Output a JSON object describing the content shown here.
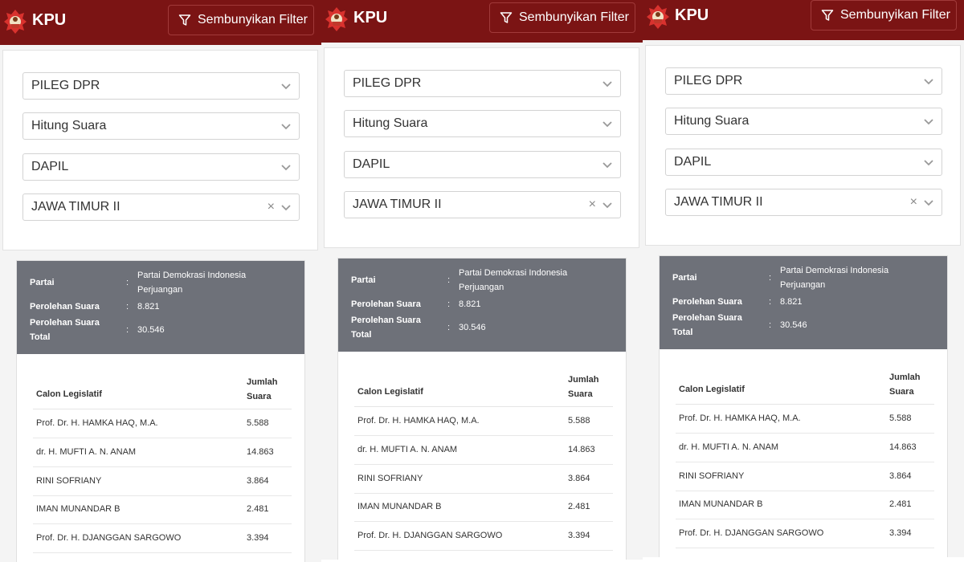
{
  "header": {
    "brand": "KPU",
    "filter_button_label": "Sembunyikan Filter"
  },
  "filters": [
    {
      "value": "PILEG DPR",
      "clearable": false
    },
    {
      "value": "Hitung Suara",
      "clearable": false
    },
    {
      "value": "DAPIL",
      "clearable": false
    },
    {
      "value": "JAWA TIMUR II",
      "clearable": true,
      "clear_symbol": "×"
    }
  ],
  "summary": {
    "party_label": "Partai",
    "party_value": "Partai Demokrasi Indonesia Perjuangan",
    "votes_label": "Perolehan Suara",
    "votes_value": "8.821",
    "total_label": "Perolehan Suara Total",
    "total_value": "30.546",
    "colon": ":"
  },
  "table": {
    "col_name": "Calon Legislatif",
    "col_votes": "Jumlah Suara",
    "rows": [
      {
        "name": "Prof. Dr. H. HAMKA HAQ, M.A.",
        "votes": "5.588"
      },
      {
        "name": "dr. H. MUFTI A. N. ANAM",
        "votes": "14.863"
      },
      {
        "name": "RINI SOFRIANY",
        "votes": "3.864"
      },
      {
        "name": "IMAN MUNANDAR B",
        "votes": "2.481"
      },
      {
        "name": "Prof. Dr. H. DJANGGAN SARGOWO",
        "votes": "3.394"
      }
    ]
  },
  "colors": {
    "header_bg": "#7b1414",
    "summary_bg": "#6e7179"
  },
  "icons": [
    "kpu-logo-icon",
    "filter-funnel-icon",
    "chevron-down-icon",
    "clear-icon"
  ]
}
